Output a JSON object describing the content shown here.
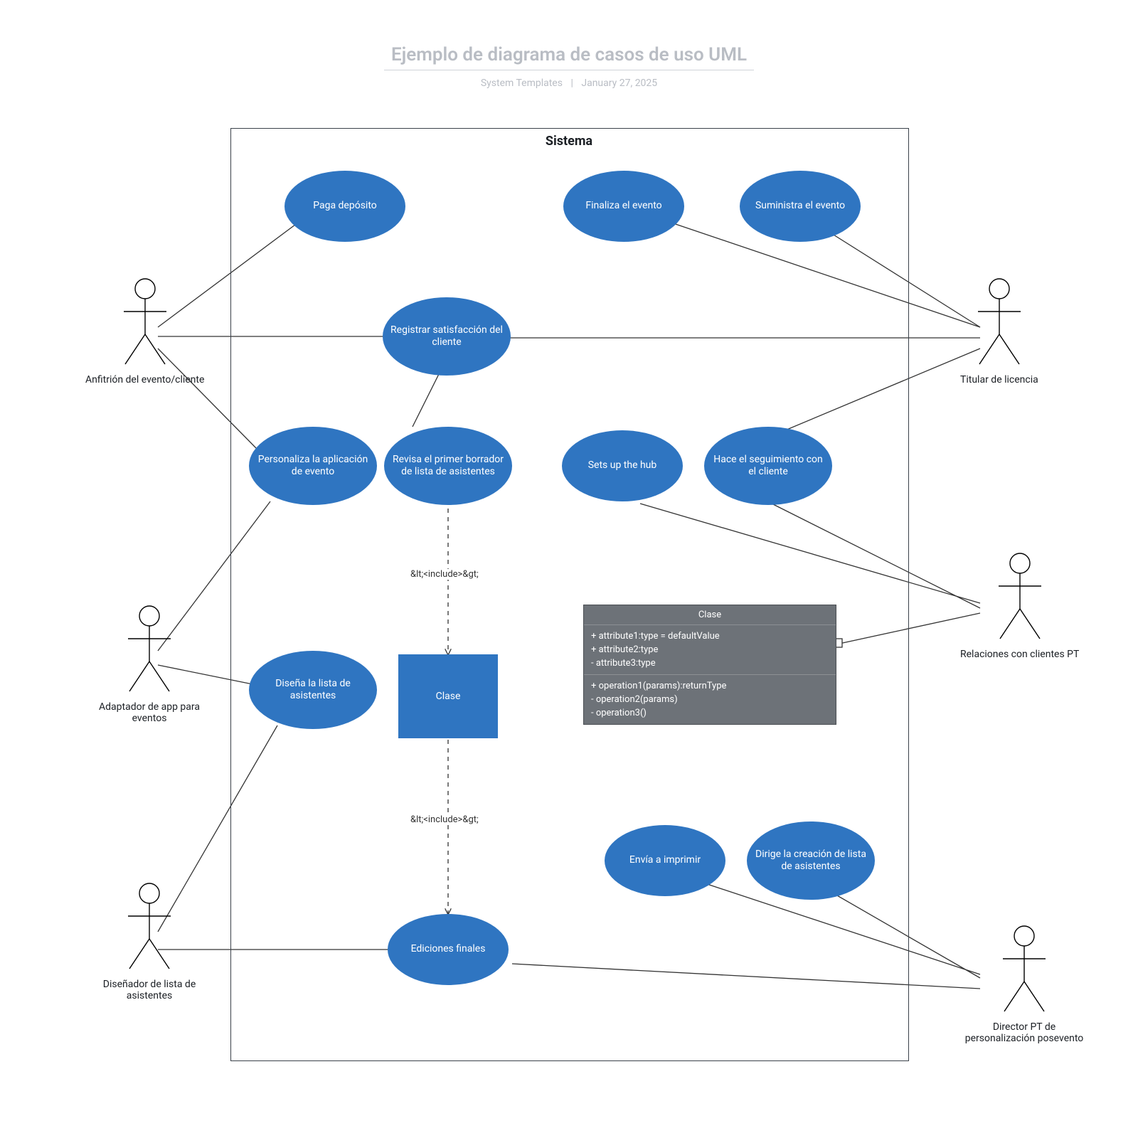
{
  "header": {
    "title": "Ejemplo de diagrama de casos de uso UML",
    "subtitle_left": "System Templates",
    "subtitle_right": "January 27, 2025"
  },
  "system": {
    "label": "Sistema"
  },
  "useCases": {
    "paga": "Paga depósito",
    "finaliza": "Finaliza el evento",
    "suministra": "Suministra el evento",
    "registrar": "Registrar satisfacción del cliente",
    "personaliza": "Personaliza la aplicación de evento",
    "revisa": "Revisa el primer borrador de lista de asistentes",
    "setsUp": "Sets up the hub",
    "seguimiento": "Hace el seguimiento con el cliente",
    "disena": "Diseña la lista de asistentes",
    "clase": "Clase",
    "envia": "Envía a imprimir",
    "dirige": "Dirige la creación de lista de asistentes",
    "ediciones": "Ediciones finales"
  },
  "includeLabel": "&lt;<include>&gt;",
  "classBox": {
    "title": "Clase",
    "attrs": [
      "+ attribute1:type = defaultValue",
      "+ attribute2:type",
      "- attribute3:type"
    ],
    "ops": [
      "+ operation1(params):returnType",
      "- operation2(params)",
      "- operation3()"
    ]
  },
  "actors": {
    "anfitrion": "Anfitrión del evento/cliente",
    "adaptador": "Adaptador de app para eventos",
    "disenador": "Diseñador de lista de asistentes",
    "titular": "Titular de licencia",
    "relaciones": "Relaciones con clientes PT",
    "director": "Director PT de personalización posevento"
  }
}
